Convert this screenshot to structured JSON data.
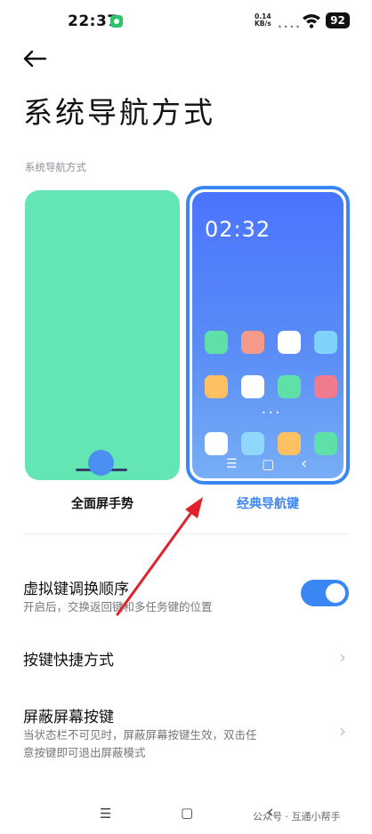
{
  "status_bar": {
    "time": "22:37",
    "speed_value": "0.14",
    "speed_unit": "KB/s",
    "battery": "92",
    "icons": [
      "wechat-icon",
      "wifi-icon",
      "battery-icon"
    ]
  },
  "header": {
    "title": "系统导航方式"
  },
  "section": {
    "label": "系统导航方式"
  },
  "options": [
    {
      "label": "全面屏手势",
      "selected": false
    },
    {
      "label": "经典导航键",
      "selected": true
    }
  ],
  "preview": {
    "clock": "02:32",
    "app_colors": [
      [
        "#5fe0a8",
        "#f59a88",
        "#ffffff",
        "#7fd2fa"
      ],
      [
        "#fdc062",
        "#ffffff",
        "#5fe0a8",
        "#f07b8c"
      ],
      [
        "#ffffff",
        "#8fd8fb",
        "#fdc062",
        "#5fe0a8"
      ]
    ],
    "nav_keys": [
      "☰",
      "▢",
      "‹"
    ]
  },
  "settings": [
    {
      "title": "虚拟键调换顺序",
      "subtitle": "开启后，交换返回键和多任务键的位置",
      "control": "toggle",
      "on": true
    },
    {
      "title": "按键快捷方式",
      "subtitle": "",
      "control": "chevron"
    },
    {
      "title": "屏蔽屏幕按键",
      "subtitle_line1": "当状态栏不可见时，屏蔽屏幕按键生效，双击任",
      "subtitle_line2": "意按键即可退出屏蔽模式",
      "control": "chevron"
    }
  ],
  "bottom_nav": {
    "menu": "☰",
    "home": "▢",
    "back": "‹"
  },
  "watermark": "公众号 · 互通小帮手",
  "colors": {
    "accent": "#3a86f4",
    "green_card": "#63e6b4",
    "annotation_arrow": "#e0232a"
  }
}
